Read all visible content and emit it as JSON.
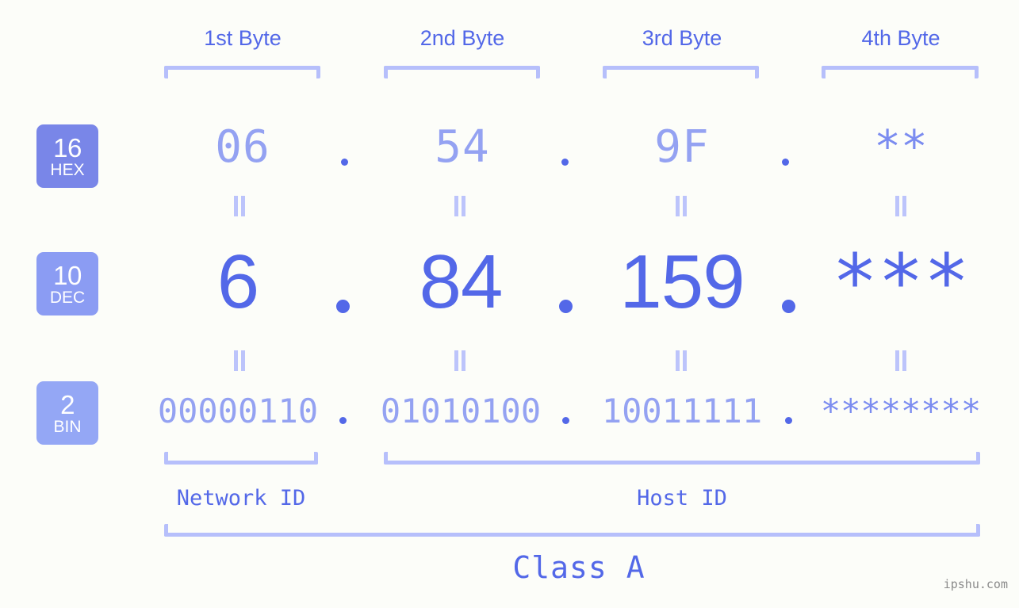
{
  "background_color": "#fcfdf9",
  "accent_color": "#5368e8",
  "accent_light_color": "#94a2f2",
  "bracket_color": "#b6bffb",
  "headers": [
    {
      "label": "1st Byte"
    },
    {
      "label": "2nd Byte"
    },
    {
      "label": "3rd Byte"
    },
    {
      "label": "4th Byte"
    }
  ],
  "bases": [
    {
      "number": "16",
      "name": "HEX",
      "color": "#7986e8"
    },
    {
      "number": "10",
      "name": "DEC",
      "color": "#8b9cf3"
    },
    {
      "number": "2",
      "name": "BIN",
      "color": "#94a7f5"
    }
  ],
  "rows": {
    "hex": {
      "values": [
        "06",
        "54",
        "9F",
        "**"
      ]
    },
    "dec": {
      "values": [
        "6",
        "84",
        "159",
        "***"
      ]
    },
    "bin": {
      "values": [
        "00000110",
        "01010100",
        "10011111",
        "********"
      ]
    }
  },
  "separator": ".",
  "equals_symbol": "=",
  "sections": {
    "network_id": "Network ID",
    "host_id": "Host ID",
    "class": "Class A"
  },
  "watermark": "ipshu.com"
}
